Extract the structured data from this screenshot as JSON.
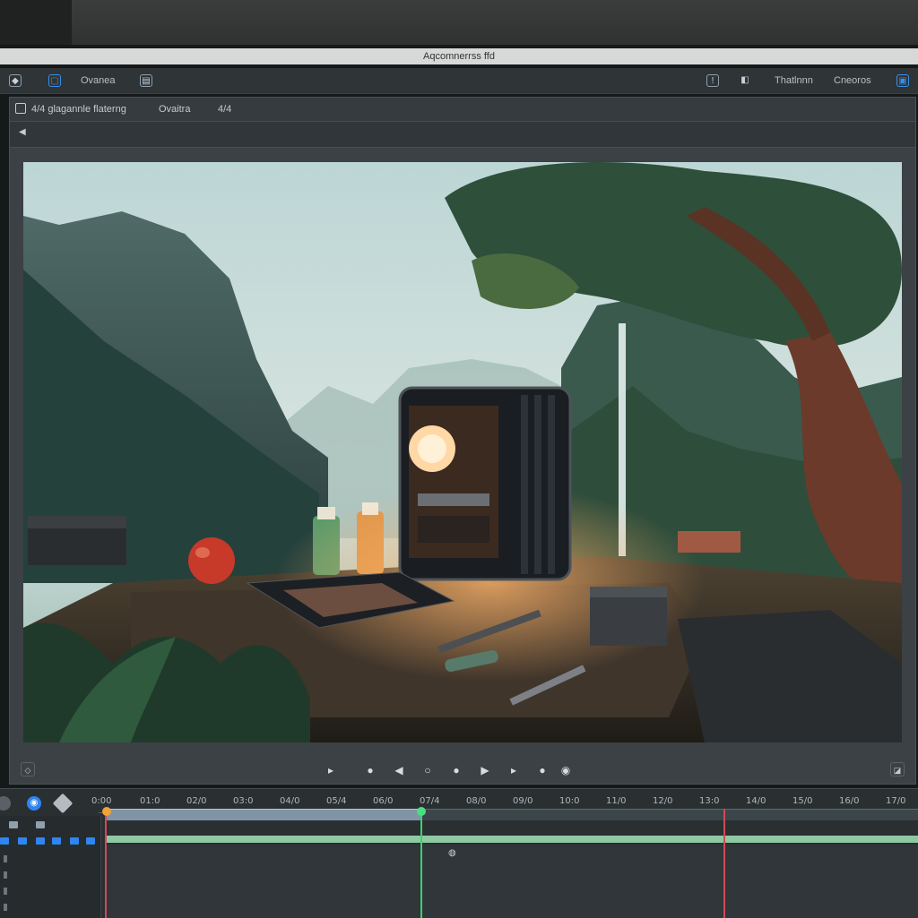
{
  "window": {
    "title": "Aqcomnerrss ffd"
  },
  "menubar": {
    "left_label": "Ovanea",
    "right_labels": [
      "Thatlnnn",
      "Cneoros"
    ]
  },
  "panel": {
    "header_label": "4/4 glagannle flaterng",
    "header_label_2": "Ovaitra",
    "header_label_3": "4/4"
  },
  "viewport": {
    "scene": "desk-in-valley",
    "icons": [
      "mountain",
      "tree",
      "waterfall",
      "pc-case",
      "apple",
      "bottles"
    ]
  },
  "transport": {
    "buttons": [
      "▶ step",
      "●",
      "◀",
      "○",
      "●",
      "▶",
      "▶ step",
      "●",
      "●"
    ]
  },
  "timeline": {
    "ticks": [
      "0:00",
      "01:0",
      "02/0",
      "03:0",
      "04/0",
      "05/4",
      "06/0",
      "07/4",
      "08/0",
      "09/0",
      "10:0",
      "11/0",
      "12/0",
      "13:0",
      "14/0",
      "15/0",
      "16/0",
      "17/0"
    ]
  },
  "colors": {
    "accent": "#2f86f0",
    "playhead_in": "#f2a23a",
    "playhead_green": "#3ed26a",
    "marker_red": "#d04a55"
  }
}
